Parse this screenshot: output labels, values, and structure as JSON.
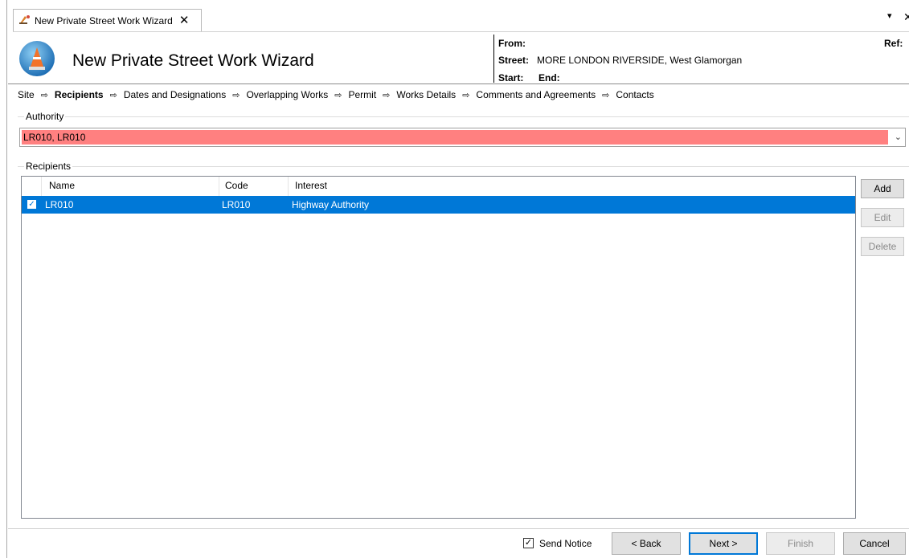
{
  "tab": {
    "title": "New Private Street Work Wizard",
    "close_glyph": "✕"
  },
  "tab_strip": {
    "menu_glyph": "▾",
    "close_glyph": "✕"
  },
  "header": {
    "title": "New Private Street Work Wizard",
    "from_label": "From:",
    "street_label": "Street:",
    "street_value": "MORE LONDON RIVERSIDE, West Glamorgan",
    "start_label": "Start:",
    "end_label": "End:",
    "ref_label": "Ref:"
  },
  "steps": [
    {
      "label": "Site",
      "current": false
    },
    {
      "label": "Recipients",
      "current": true
    },
    {
      "label": "Dates and Designations",
      "current": false
    },
    {
      "label": "Overlapping Works",
      "current": false
    },
    {
      "label": "Permit",
      "current": false
    },
    {
      "label": "Works Details",
      "current": false
    },
    {
      "label": "Comments and Agreements",
      "current": false
    },
    {
      "label": "Contacts",
      "current": false
    }
  ],
  "step_arrow": "⇨",
  "authority": {
    "group_label": "Authority",
    "value": "LR010, LR010",
    "highlight_color": "#ff8080"
  },
  "recipients": {
    "group_label": "Recipients",
    "columns": {
      "name": "Name",
      "code": "Code",
      "interest": "Interest"
    },
    "rows": [
      {
        "checked": true,
        "name": "LR010",
        "code": "LR010",
        "interest": "Highway Authority",
        "selected": true
      }
    ],
    "selection_color": "#0078d7"
  },
  "side_buttons": {
    "add": "Add",
    "edit": "Edit",
    "delete": "Delete"
  },
  "footer": {
    "send_notice_label": "Send Notice",
    "send_notice_checked": true,
    "back": "< Back",
    "next": "Next >",
    "finish": "Finish",
    "cancel": "Cancel"
  }
}
